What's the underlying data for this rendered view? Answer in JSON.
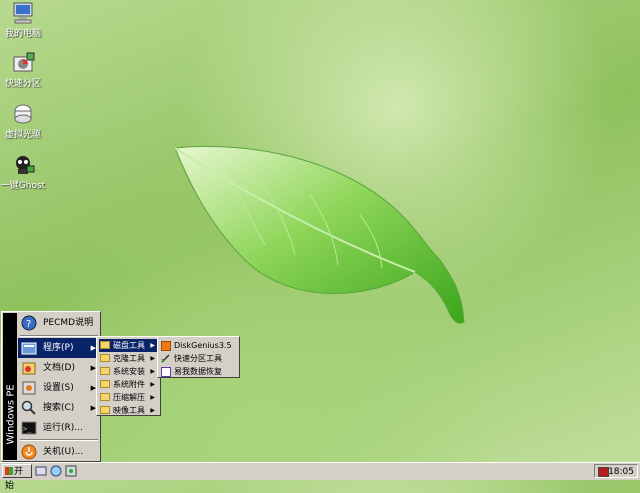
{
  "desktop": {
    "icons": [
      {
        "label": "我的电脑",
        "icon": "computer-icon"
      },
      {
        "label": "快速分区",
        "icon": "partition-icon"
      },
      {
        "label": "虚拟光驱",
        "icon": "virtual-drive-icon"
      },
      {
        "label": "一键Ghost",
        "icon": "ghost-icon"
      }
    ]
  },
  "start_menu": {
    "sidebar_text": "Windows PE",
    "items": [
      {
        "label": "PECMD说明",
        "icon": "help-icon"
      },
      {
        "label": "程序(P)",
        "icon": "programs-icon"
      },
      {
        "label": "文档(D)",
        "icon": "documents-icon"
      },
      {
        "label": "设置(S)",
        "icon": "settings-icon"
      },
      {
        "label": "搜索(C)",
        "icon": "search-icon"
      },
      {
        "label": "运行(R)...",
        "icon": "run-icon"
      },
      {
        "label": "关机(U)...",
        "icon": "shutdown-icon"
      }
    ]
  },
  "programs_menu": {
    "items": [
      {
        "label": "磁盘工具"
      },
      {
        "label": "克隆工具"
      },
      {
        "label": "系统安装"
      },
      {
        "label": "系统附件"
      },
      {
        "label": "压缩解压"
      },
      {
        "label": "映像工具"
      }
    ]
  },
  "disk_tools_menu": {
    "items": [
      {
        "label": "DiskGenius3.5",
        "icon": "diskgenius-icon"
      },
      {
        "label": "快速分区工具",
        "icon": "partition-tool-icon"
      },
      {
        "label": "易我数据恢复",
        "icon": "data-recovery-icon"
      }
    ]
  },
  "taskbar": {
    "start_label": "开始",
    "clock": "18:05"
  },
  "colors": {
    "menu_highlight": "#0a246a",
    "menu_bg": "#d4d0c8"
  }
}
